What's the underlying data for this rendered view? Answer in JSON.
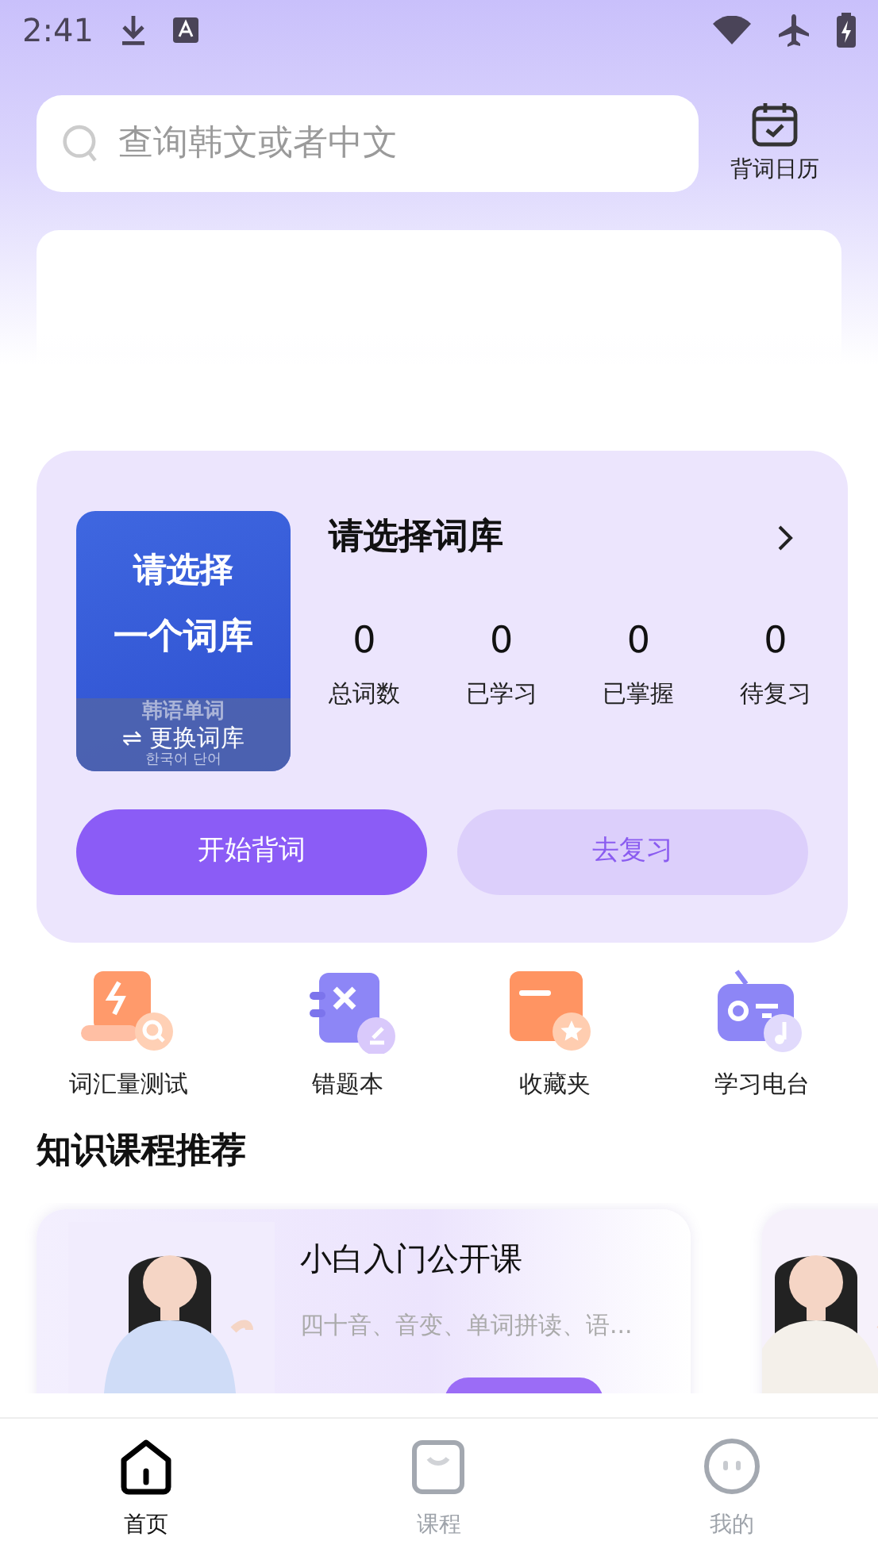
{
  "status_bar": {
    "time": "2:41"
  },
  "search": {
    "placeholder": "查询韩文或者中文"
  },
  "calendar_button": {
    "label": "背词日历"
  },
  "word_bank": {
    "cover_lines": [
      "请选择",
      "一个词库"
    ],
    "cover_series": "韩语单词",
    "cover_action": "⇌ 更换词库",
    "cover_korean": "한국어 단어",
    "title": "请选择词库",
    "stats": [
      {
        "value": "0",
        "label": "总词数"
      },
      {
        "value": "0",
        "label": "已学习"
      },
      {
        "value": "0",
        "label": "已掌握"
      },
      {
        "value": "0",
        "label": "待复习"
      }
    ],
    "buttons": [
      {
        "label": "开始背词",
        "kind": "primary"
      },
      {
        "label": "去复习",
        "kind": "secondary"
      }
    ]
  },
  "shortcuts": [
    {
      "label": "词汇量测试",
      "kind": "test"
    },
    {
      "label": "错题本",
      "kind": "mistakes"
    },
    {
      "label": "收藏夹",
      "kind": "favorites"
    },
    {
      "label": "学习电台",
      "kind": "radio"
    }
  ],
  "courses": {
    "heading": "知识课程推荐",
    "items": [
      {
        "title": "小白入门公开课",
        "subtitle": "四十音、音变、单词拼读、语..."
      }
    ]
  },
  "tab_bar": [
    {
      "label": "首页",
      "kind": "home",
      "selected": true
    },
    {
      "label": "课程",
      "kind": "courses",
      "selected": false
    },
    {
      "label": "我的",
      "kind": "me",
      "selected": false
    }
  ]
}
